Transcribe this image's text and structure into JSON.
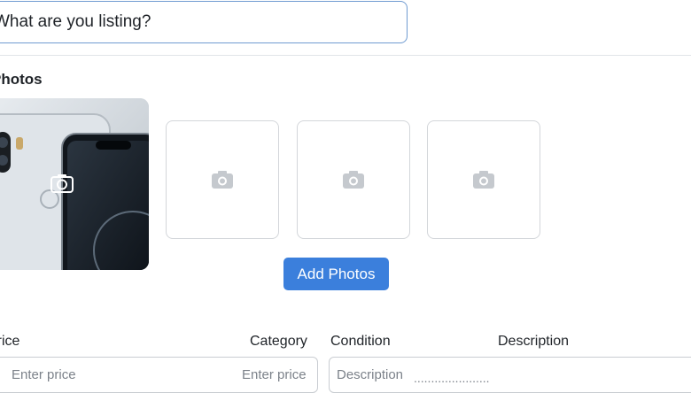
{
  "listing": {
    "title_placeholder": "What are you listing?"
  },
  "photos": {
    "section_label": "Photos",
    "main_photo_icon": "camera-icon",
    "empty_slot_icon": "camera-icon",
    "add_button_label": "Add Photos"
  },
  "fields": {
    "price_label": "Price",
    "price_placeholder": "Enter price",
    "category_label": "Category",
    "category_placeholder": "Enter price",
    "condition_label": "Condition",
    "description_label": "Description",
    "description_placeholder": "Description",
    "description_dots": "......................"
  },
  "colors": {
    "accent": "#3b7fdc",
    "input_focus_border": "#6f9bd1"
  }
}
